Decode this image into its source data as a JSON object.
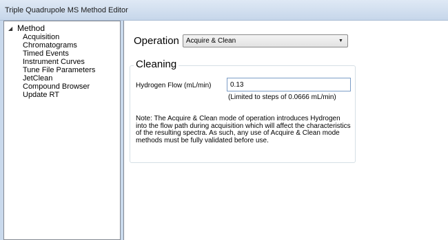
{
  "window": {
    "title": "Triple Quadrupole MS Method Editor"
  },
  "tree": {
    "toggle_glyph": "◢",
    "root_label": "Method",
    "items": [
      {
        "label": "Acquisition"
      },
      {
        "label": "Chromatograms"
      },
      {
        "label": "Timed Events"
      },
      {
        "label": "Instrument Curves"
      },
      {
        "label": "Tune File Parameters"
      },
      {
        "label": "JetClean"
      },
      {
        "label": "Compound Browser"
      },
      {
        "label": "Update RT"
      }
    ]
  },
  "operation": {
    "label": "Operation",
    "selected": "Acquire & Clean",
    "arrow_glyph": "▼"
  },
  "cleaning": {
    "title": "Cleaning",
    "hydrogen_flow_label": "Hydrogen Flow (mL/min)",
    "hydrogen_flow_value": "0.13",
    "hint": "(Limited to steps of 0.0666 mL/min)",
    "note": "Note: The Acquire & Clean mode of operation introduces Hydrogen into the flow path during acquisition which will affect the characteristics of the resulting spectra. As such, any use of Acquire & Clean mode methods must be fully validated before use."
  }
}
